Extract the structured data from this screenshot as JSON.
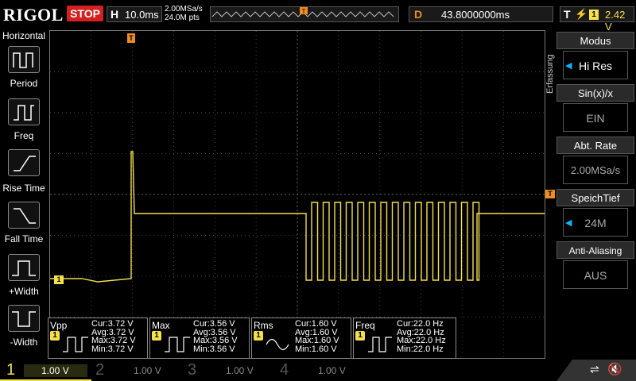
{
  "brand": "RIGOL",
  "status": "STOP",
  "horizontal": {
    "letter": "H",
    "timebase": "10.0ms",
    "sample_rate": "2.00MSa/s",
    "points": "24.0M pts"
  },
  "delay": {
    "letter": "D",
    "value": "43.8000000ms"
  },
  "trigger": {
    "letter": "T",
    "source": "1",
    "level": "2.42 V"
  },
  "left_menu": {
    "title": "Horizontal",
    "items": [
      {
        "label": "Period"
      },
      {
        "label": "Freq"
      },
      {
        "label": "Rise Time"
      },
      {
        "label": "Fall Time"
      },
      {
        "label": "+Width"
      },
      {
        "label": "-Width"
      }
    ]
  },
  "right_menu": {
    "side_label": "Erfassung",
    "items": [
      {
        "head": "Modus",
        "value": "Hi Res"
      },
      {
        "head": "Sin(x)/x",
        "value": "EIN"
      },
      {
        "head": "Abt. Rate",
        "value": "2.00MSa/s"
      },
      {
        "head": "SpeichTief",
        "value": "24M"
      },
      {
        "head": "Anti-Aliasing",
        "value": "AUS"
      }
    ]
  },
  "measurements": [
    {
      "name": "Vpp",
      "channel": "1",
      "cur": "Cur:3.72 V",
      "avg": "Avg:3.72 V",
      "max": "Max:3.72 V",
      "min": "Min:3.72 V"
    },
    {
      "name": "Max",
      "channel": "1",
      "cur": "Cur:3.56 V",
      "avg": "Avg:3.56 V",
      "max": "Max:3.56 V",
      "min": "Min:3.56 V"
    },
    {
      "name": "Rms",
      "channel": "1",
      "cur": "Cur:1.60 V",
      "avg": "Avg:1.60 V",
      "max": "Max:1.60 V",
      "min": "Min:1.60 V"
    },
    {
      "name": "Freq",
      "channel": "1",
      "cur": "Cur:22.0 Hz",
      "avg": "Avg:22.0 Hz",
      "max": "Max:22.0 Hz",
      "min": "Min:22.0 Hz"
    }
  ],
  "channels": [
    {
      "num": "1",
      "scale": "1.00 V",
      "color": "#f4e04a"
    },
    {
      "num": "2",
      "scale": "1.00 V",
      "color": "#555555"
    },
    {
      "num": "3",
      "scale": "1.00 V",
      "color": "#555555"
    },
    {
      "num": "4",
      "scale": "1.00 V",
      "color": "#555555"
    }
  ],
  "markers": {
    "channel_marker": "1",
    "trigger_marker": "T"
  },
  "colors": {
    "ch1": "#f4e04a",
    "stop": "#d42020",
    "trigger": "#f08c1c",
    "accent": "#0ab4ff"
  }
}
